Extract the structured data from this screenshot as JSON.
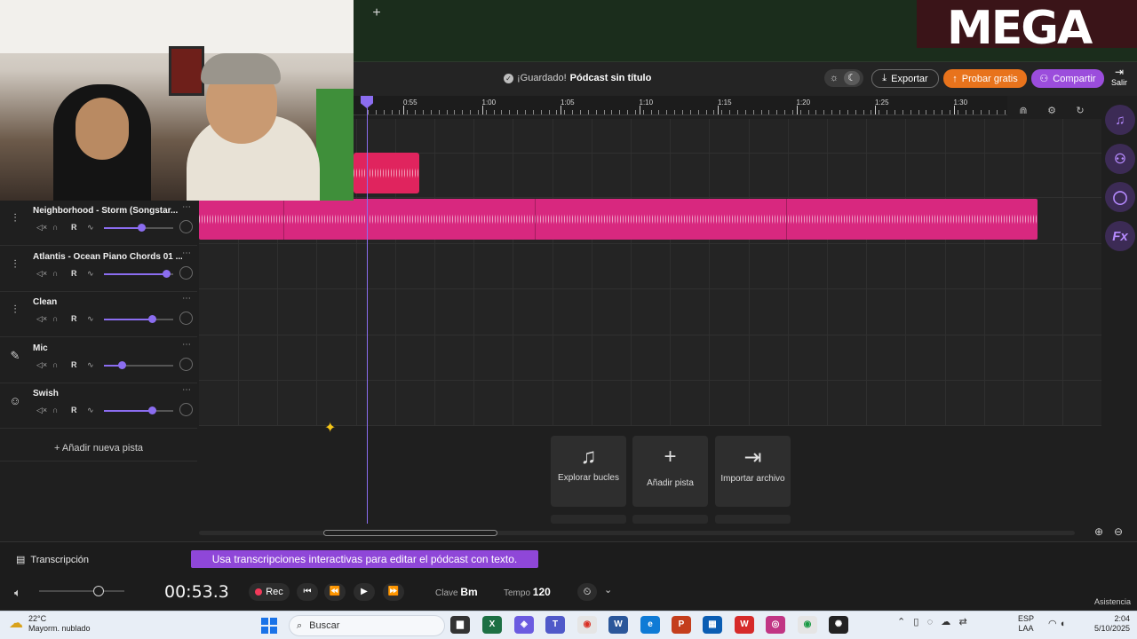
{
  "browser": {
    "new_tab_label": "+"
  },
  "overlay": {
    "logo_text": "MEGA"
  },
  "header": {
    "saved_label": "¡Guardado!",
    "project_title": "Pódcast sin título",
    "export_label": "Exportar",
    "trial_label": "Probar gratis",
    "share_label": "Compartir",
    "exit_label": "Salir"
  },
  "ruler": {
    "labels": [
      "0:55",
      "1:00",
      "1:05",
      "1:10",
      "1:15",
      "1:20",
      "1:25",
      "1:30"
    ]
  },
  "side_panel": {
    "items": [
      "music-loops",
      "collaborators",
      "comments",
      "Fx"
    ],
    "fx_label": "Fx"
  },
  "tracks": [
    {
      "name": "Neighborhood - Storm (Songstar...",
      "icon": "waveform-icon",
      "volume": 0.57
    },
    {
      "name": "Atlantis - Ocean Piano Chords 01 ...",
      "icon": "waveform-icon",
      "volume": 0.95
    },
    {
      "name": "Clean",
      "icon": "waveform-icon",
      "volume": 0.73
    },
    {
      "name": "Mic",
      "icon": "mic-icon",
      "volume": 0.27
    },
    {
      "name": "Swish",
      "icon": "swish-icon",
      "volume": 0.73
    }
  ],
  "track_controls": {
    "record_label": "R"
  },
  "add_track_label": "Añadir nueva pista",
  "actions": {
    "explore_loops": "Explorar bucles",
    "add_track": "Añadir pista",
    "import_file": "Importar archivo"
  },
  "transcription": {
    "label": "Transcripción",
    "tip": "Usa transcripciones interactivas para editar el pódcast con texto."
  },
  "transport": {
    "time": "00:53.3",
    "rec_label": "Rec",
    "key_label": "Clave",
    "key_value": "Bm",
    "tempo_label": "Tempo",
    "tempo_value": "120",
    "help_label": "Asistencia",
    "volume": 0.7
  },
  "taskbar": {
    "temperature": "22°C",
    "weather": "Mayorm. nublado",
    "search_label": "Buscar",
    "lang_1": "ESP",
    "lang_2": "LAA",
    "time": "2:04",
    "date": "5/10/2025"
  },
  "colors": {
    "accent": "#8b6df0",
    "clip_pink": "#d8287f",
    "clip_red": "#e0245e",
    "trial_orange": "#e8731c",
    "share_purple": "#9b4ddc"
  }
}
